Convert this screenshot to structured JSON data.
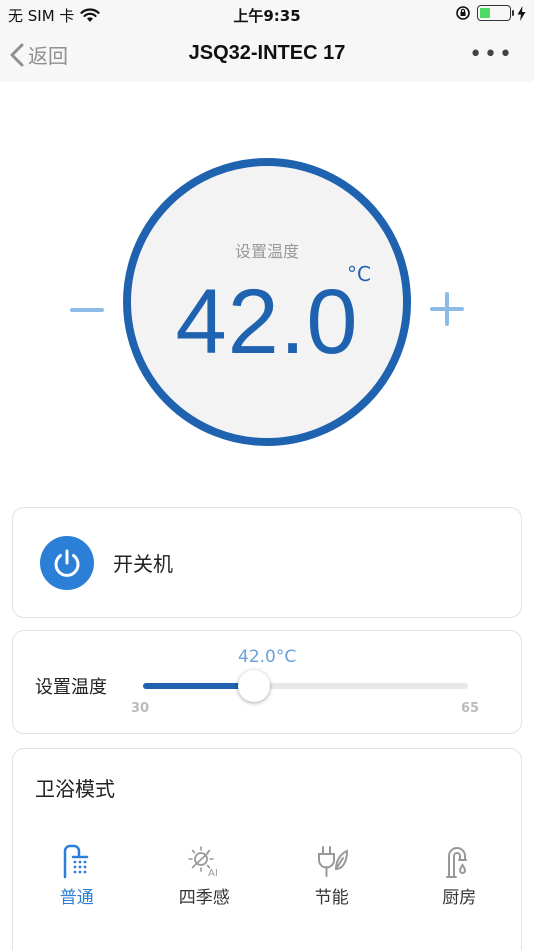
{
  "status_bar": {
    "carrier": "无 SIM 卡",
    "time": "上午9:35",
    "battery_level": 0.35,
    "icons": [
      "wifi-icon",
      "orientation-lock-icon",
      "battery-icon",
      "charging-icon"
    ]
  },
  "nav": {
    "back_label": "返回",
    "title": "JSQ32-INTEC 17",
    "more_label": "•••"
  },
  "dial": {
    "label": "设置温度",
    "value": "42.0",
    "unit": "°C"
  },
  "power": {
    "label": "开关机",
    "icon": "power-icon"
  },
  "temperature": {
    "label": "设置温度",
    "value_label": "42.0°C",
    "value": 42.0,
    "min": 30,
    "max": 65
  },
  "modes": {
    "title": "卫浴模式",
    "items": [
      {
        "label": "普通",
        "icon": "shower-icon",
        "active": true
      },
      {
        "label": "四季感",
        "icon": "ai-sun-snow-icon",
        "active": false
      },
      {
        "label": "节能",
        "icon": "eco-plug-icon",
        "active": false
      },
      {
        "label": "厨房",
        "icon": "faucet-icon",
        "active": false
      }
    ]
  },
  "colors": {
    "primary": "#1f63b0",
    "accent": "#2b7fd6",
    "light_blue": "#8dbbe8",
    "inactive_icon": "#999999"
  }
}
